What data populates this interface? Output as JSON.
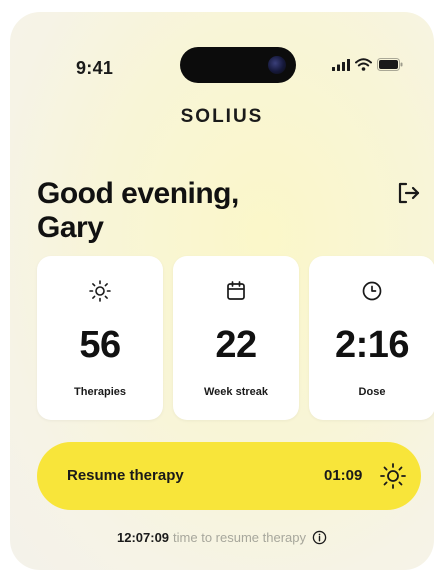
{
  "status_bar": {
    "time": "9:41",
    "icons": [
      "signal-icon",
      "wifi-icon",
      "battery-icon"
    ]
  },
  "brand": {
    "name": "SOLIUS"
  },
  "greeting": {
    "line1": "Good evening,",
    "line2": "Gary"
  },
  "stats": [
    {
      "icon": "sun-icon",
      "value": "56",
      "label": "Therapies"
    },
    {
      "icon": "calendar-icon",
      "value": "22",
      "label": "Week streak"
    },
    {
      "icon": "clock-icon",
      "value": "2:16",
      "label": "Dose"
    }
  ],
  "resume": {
    "label": "Resume therapy",
    "time": "01:09",
    "icon": "sun-icon"
  },
  "footer": {
    "countdown": "12:07:09",
    "text": "time to resume therapy",
    "icon": "info-icon"
  },
  "colors": {
    "accent": "#f8e53a",
    "text": "#111111",
    "muted": "#a7a79c",
    "card": "#ffffff",
    "background": "#f8f5d7"
  }
}
